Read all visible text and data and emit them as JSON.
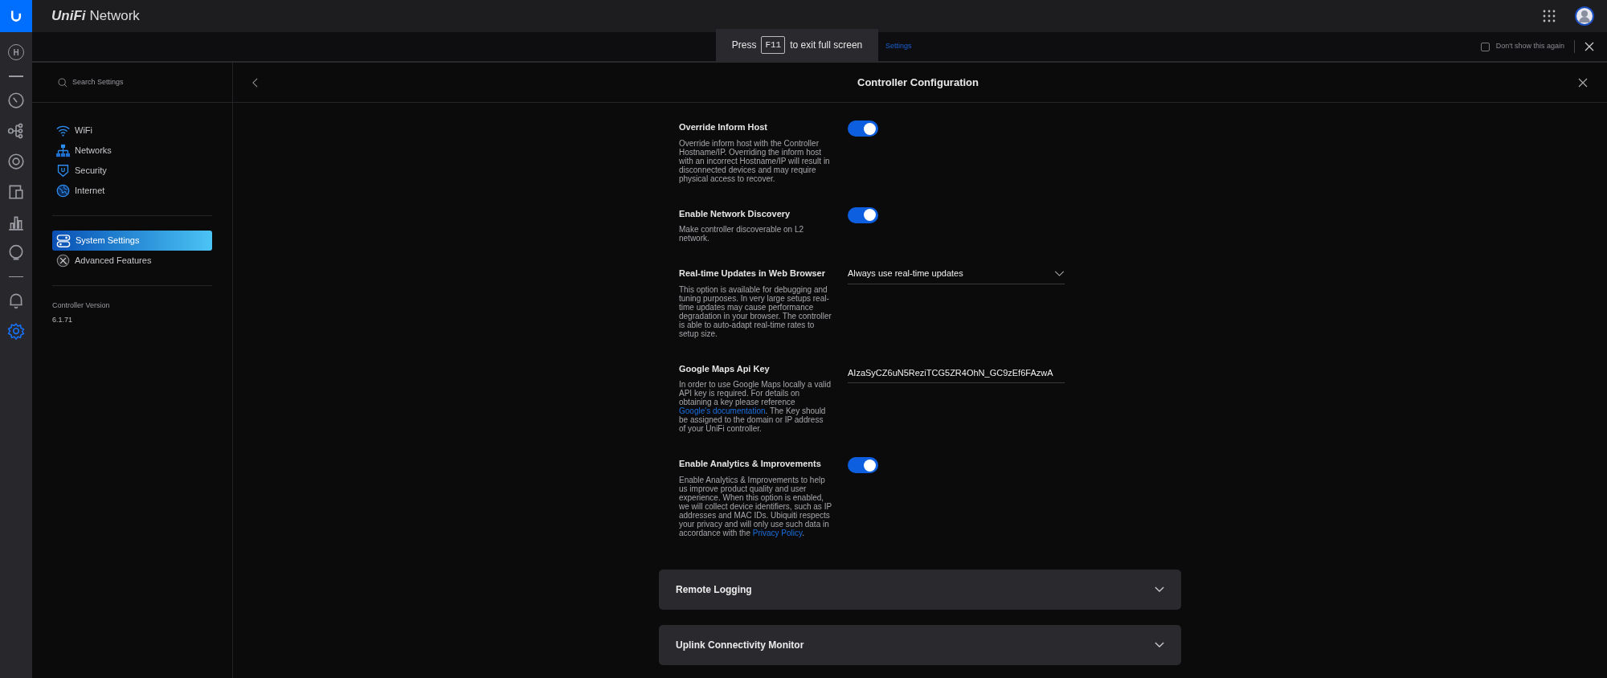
{
  "app": {
    "title_brand": "UniFi",
    "title_product": "Network"
  },
  "rail": [
    {
      "kind": "home",
      "label": "H",
      "selected": false
    },
    {
      "kind": "gauge",
      "selected": false
    },
    {
      "kind": "topology",
      "selected": false
    },
    {
      "kind": "target",
      "selected": false
    },
    {
      "kind": "devices",
      "selected": false
    },
    {
      "kind": "stats",
      "selected": false
    },
    {
      "kind": "bulb",
      "selected": false
    },
    {
      "kind": "bell",
      "selected": false
    },
    {
      "kind": "gear",
      "selected": true
    }
  ],
  "banner": {
    "link": "Settings",
    "checkbox": {
      "label": "Don't show this again",
      "checked": false
    }
  },
  "fullscreen_hint": {
    "before": "Press",
    "key": "F11",
    "after": "to exit full screen"
  },
  "sidebar": {
    "search": {
      "placeholder": "Search Settings"
    },
    "groups": [
      [
        {
          "kind": "wifi",
          "label": "WiFi",
          "selected": false
        },
        {
          "kind": "networks",
          "label": "Networks",
          "selected": false
        },
        {
          "kind": "security",
          "label": "Security",
          "selected": false
        },
        {
          "kind": "internet",
          "label": "Internet",
          "selected": false
        }
      ],
      [
        {
          "kind": "system",
          "label": "System Settings",
          "selected": true
        },
        {
          "kind": "advanced",
          "label": "Advanced Features",
          "selected": false
        }
      ]
    ],
    "version_label": "Controller Version",
    "version": "6.1.71"
  },
  "panel": {
    "title": "Controller Configuration",
    "settings": [
      {
        "kind": "toggle",
        "label": "Override Inform Host",
        "description": "Override inform host with the Controller Hostname/IP. Overriding the inform host with an incorrect Hostname/IP will result in disconnected devices and may require physical access to recover.",
        "on": true
      },
      {
        "kind": "toggle",
        "label": "Enable Network Discovery",
        "description": "Make controller discoverable on L2 network.",
        "on": true
      },
      {
        "kind": "select",
        "label": "Real-time Updates in Web Browser",
        "description": "This option is available for debugging and tuning purposes. In very large setups real-time updates may cause performance degradation in your browser. The controller is able to auto-adapt real-time rates to setup size.",
        "value": "Always use real-time updates"
      },
      {
        "kind": "input",
        "label": "Google Maps Api Key",
        "description": "In order to use Google Maps locally a valid API key is required. For details on obtaining a key please reference ",
        "link": "Google's documentation",
        "description_after": ". The Key should be assigned to the domain or IP address of your UniFi controller.",
        "value": "AIzaSyCZ6uN5ReziTCG5ZR4OhN_GC9zEf6FAzwA"
      },
      {
        "kind": "toggle",
        "label": "Enable Analytics & Improvements",
        "description": "Enable Analytics & Improvements to help us improve product quality and user experience. When this option is enabled, we will collect device identifiers, such as IP addresses and MAC IDs. Ubiquiti respects your privacy and will only use such data in accordance with the ",
        "link": "Privacy Policy",
        "description_after": ".",
        "on": true
      }
    ],
    "sections": [
      {
        "label": "Remote Logging",
        "expanded": false
      },
      {
        "label": "Uplink Connectivity Monitor",
        "expanded": false
      }
    ]
  }
}
